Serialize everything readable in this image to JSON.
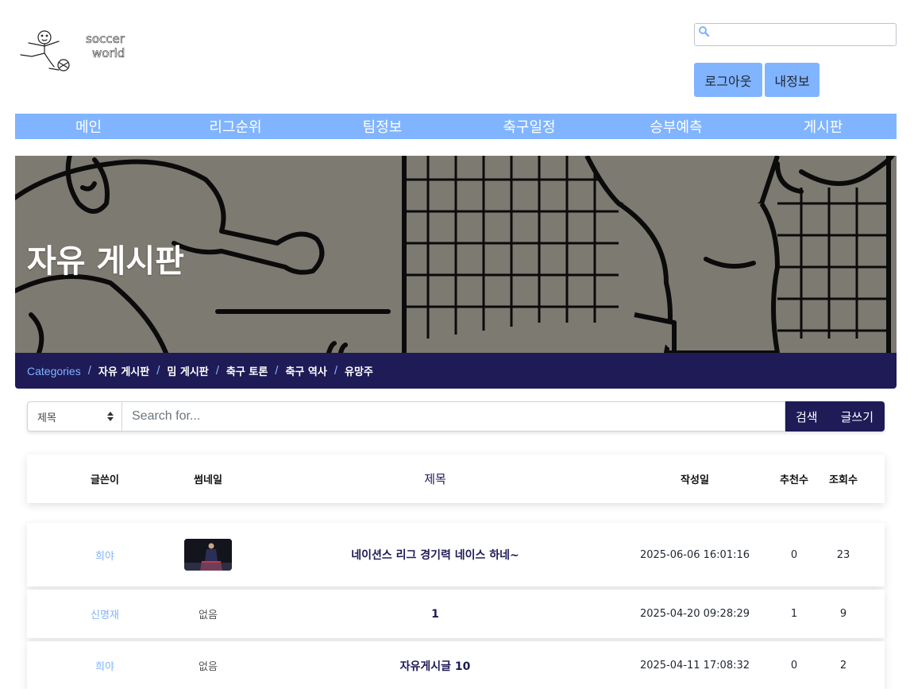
{
  "header": {
    "logo_text": "soccer world",
    "search_placeholder": "",
    "logout_label": "로그아웃",
    "myinfo_label": "내정보"
  },
  "nav": {
    "items": [
      "메인",
      "리그순위",
      "팀정보",
      "축구일정",
      "승부예측",
      "게시판"
    ]
  },
  "banner": {
    "title": "자유 게시판"
  },
  "breadcrumb": {
    "root": "Categories",
    "items": [
      "자유 게시판",
      "밈 게시판",
      "축구 토론",
      "축구 역사",
      "유망주"
    ]
  },
  "search_bar": {
    "field_selected": "제목",
    "placeholder": "Search for...",
    "search_label": "검색",
    "write_label": "글쓰기"
  },
  "table": {
    "headers": {
      "author": "글쓴이",
      "thumbnail": "썸네일",
      "title": "제목",
      "date": "작성일",
      "recommend": "추천수",
      "views": "조회수"
    },
    "rows": [
      {
        "author": "희야",
        "thumbnail": "image",
        "title": "네이션스 리그 경기력 네이스 하네~",
        "date": "2025-06-06 16:01:16",
        "recommend": "0",
        "views": "23"
      },
      {
        "author": "신명재",
        "thumbnail": "없음",
        "title": "1",
        "date": "2025-04-20 09:28:29",
        "recommend": "1",
        "views": "9"
      },
      {
        "author": "희야",
        "thumbnail": "없음",
        "title": "자유게시글 10",
        "date": "2025-04-11 17:08:32",
        "recommend": "0",
        "views": "2"
      }
    ]
  },
  "colors": {
    "accent": "#80b4ff",
    "navy": "#1e1b57",
    "banner_bg": "#7d7a72"
  }
}
